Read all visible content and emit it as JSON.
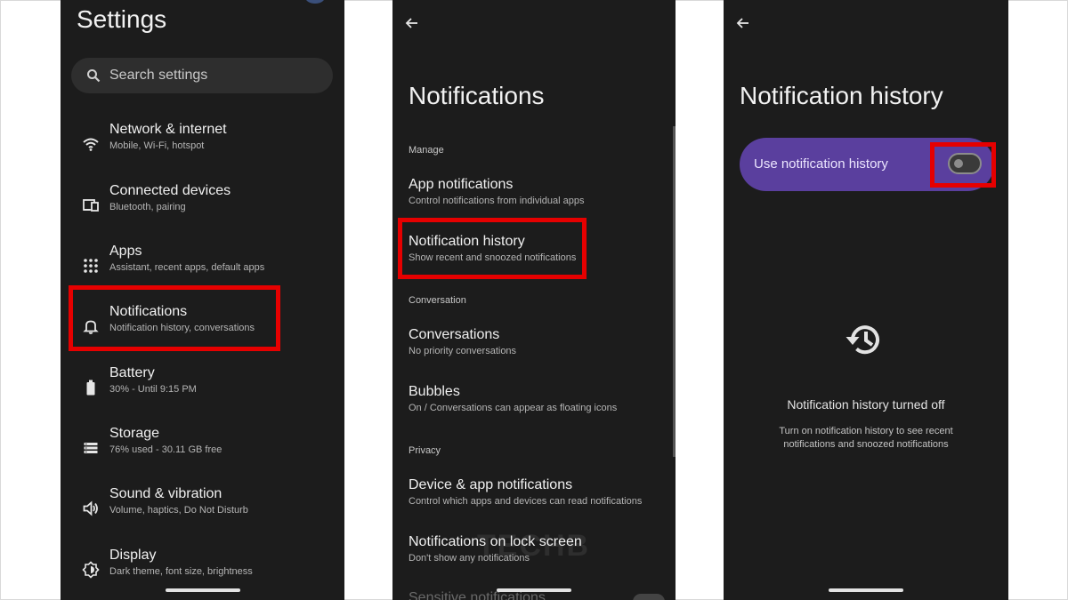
{
  "settings": {
    "title": "Settings",
    "search_placeholder": "Search settings",
    "items": [
      {
        "title": "Network & internet",
        "subtitle": "Mobile, Wi-Fi, hotspot",
        "icon": "wifi-icon"
      },
      {
        "title": "Connected devices",
        "subtitle": "Bluetooth, pairing",
        "icon": "devices-icon"
      },
      {
        "title": "Apps",
        "subtitle": "Assistant, recent apps, default apps",
        "icon": "apps-grid-icon"
      },
      {
        "title": "Notifications",
        "subtitle": "Notification history, conversations",
        "icon": "bell-icon"
      },
      {
        "title": "Battery",
        "subtitle": "30% - Until 9:15 PM",
        "icon": "battery-icon"
      },
      {
        "title": "Storage",
        "subtitle": "76% used - 30.11 GB free",
        "icon": "storage-icon"
      },
      {
        "title": "Sound & vibration",
        "subtitle": "Volume, haptics, Do Not Disturb",
        "icon": "speaker-icon"
      },
      {
        "title": "Display",
        "subtitle": "Dark theme, font size, brightness",
        "icon": "brightness-icon"
      }
    ]
  },
  "notifications": {
    "title": "Notifications",
    "sections": [
      "Manage",
      "Conversation",
      "Privacy"
    ],
    "items": [
      {
        "title": "App notifications",
        "subtitle": "Control notifications from individual apps"
      },
      {
        "title": "Notification history",
        "subtitle": "Show recent and snoozed notifications"
      },
      {
        "title": "Conversations",
        "subtitle": "No priority conversations"
      },
      {
        "title": "Bubbles",
        "subtitle": "On / Conversations can appear as floating icons"
      },
      {
        "title": "Device & app notifications",
        "subtitle": "Control which apps and devices can read notifications"
      },
      {
        "title": "Notifications on lock screen",
        "subtitle": "Don't show any notifications"
      }
    ],
    "partial_item": "Sensitive notifications",
    "watermark": "TECHB"
  },
  "history": {
    "title": "Notification history",
    "toggle_label": "Use notification history",
    "toggle_state": "off",
    "off_title": "Notification history turned off",
    "off_description": "Turn on notification history to see recent notifications and snoozed notifications"
  },
  "colors": {
    "panel_bg": "#1c1c1c",
    "highlight": "#e60000",
    "toggle_row": "#5a3f9e"
  }
}
